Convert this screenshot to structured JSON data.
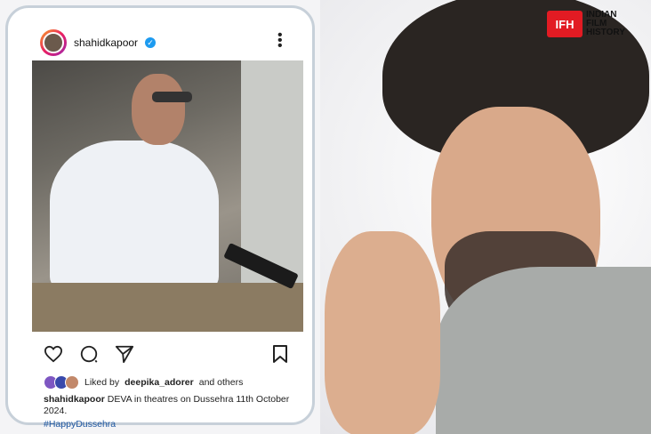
{
  "post": {
    "username": "shahidkapoor",
    "liked_prefix": "Liked by",
    "liked_user": "deepika_adorer",
    "liked_suffix": "and others",
    "caption_user": "shahidkapoor",
    "caption_text": "DEVA in theatres on Dussehra 11th October 2024.",
    "hashtag": "#HappyDussehra"
  },
  "logo": {
    "mark": "IFH",
    "line1": "INDIAN",
    "line2": "FILM",
    "line3": "HISTORY"
  },
  "colors": {
    "verified": "#1d9bf0",
    "hashtag": "#1e56a0",
    "logo_red": "#e21b23"
  },
  "icons": [
    "heart-icon",
    "comment-icon",
    "share-icon",
    "bookmark-icon",
    "more-icon",
    "verified-icon"
  ]
}
